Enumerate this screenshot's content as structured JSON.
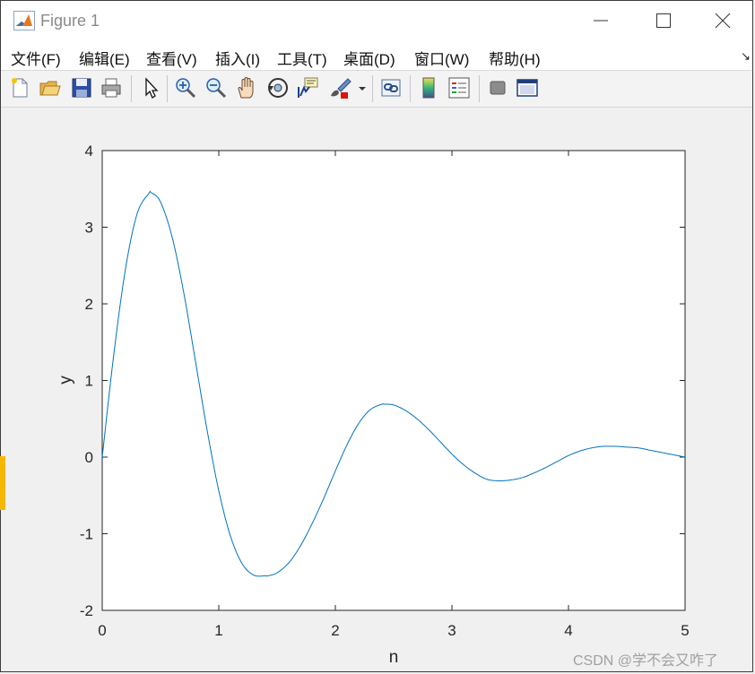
{
  "window": {
    "title": "Figure 1",
    "icon": "matlab-icon",
    "controls": [
      "minimize-icon",
      "maximize-icon",
      "close-icon"
    ]
  },
  "menu": [
    {
      "label": "文件(F)"
    },
    {
      "label": "编辑(E)"
    },
    {
      "label": "查看(V)"
    },
    {
      "label": "插入(I)"
    },
    {
      "label": "工具(T)"
    },
    {
      "label": "桌面(D)"
    },
    {
      "label": "窗口(W)"
    },
    {
      "label": "帮助(H)"
    }
  ],
  "toolbar": {
    "icons": [
      "new-figure-icon",
      "open-file-icon",
      "save-icon",
      "print-icon",
      "select-arrow-icon",
      "zoom-in-icon",
      "zoom-out-icon",
      "pan-hand-icon",
      "rotate-3d-icon",
      "data-cursor-icon",
      "brush-icon",
      "brush-dropdown-icon",
      "link-plot-icon",
      "colorbar-icon",
      "legend-icon",
      "hide-plot-tools-icon",
      "show-plot-tools-icon"
    ]
  },
  "chart_data": {
    "type": "line",
    "xlabel": "n",
    "ylabel": "y",
    "title": "",
    "xlim": [
      0,
      5
    ],
    "ylim": [
      -2,
      4
    ],
    "xticks": [
      "0",
      "1",
      "2",
      "3",
      "4",
      "5"
    ],
    "yticks": [
      "-2",
      "-1",
      "0",
      "1",
      "2",
      "3",
      "4"
    ],
    "grid": false,
    "line_color": "#0072bd",
    "series": [
      {
        "x": [
          0,
          0.1,
          0.2,
          0.3,
          0.4,
          0.42,
          0.5,
          0.6,
          0.7,
          0.8,
          0.9,
          1.0,
          1.1,
          1.2,
          1.3,
          1.4,
          1.42,
          1.5,
          1.6,
          1.7,
          1.8,
          1.9,
          2.0,
          2.1,
          2.2,
          2.3,
          2.4,
          2.42,
          2.5,
          2.6,
          2.7,
          2.8,
          2.9,
          3.0,
          3.1,
          3.2,
          3.3,
          3.4,
          3.42,
          3.5,
          3.6,
          3.7,
          3.8,
          3.9,
          4.0,
          4.1,
          4.2,
          4.3,
          4.4,
          4.42,
          4.5,
          4.6,
          4.7,
          4.8,
          4.9,
          5.0
        ],
        "y": [
          0,
          1.35,
          2.46,
          3.18,
          3.44,
          3.45,
          3.33,
          2.87,
          2.14,
          1.25,
          0.35,
          -0.44,
          -1.03,
          -1.39,
          -1.54,
          -1.55,
          -1.55,
          -1.51,
          -1.38,
          -1.16,
          -0.87,
          -0.54,
          -0.18,
          0.16,
          0.44,
          0.62,
          0.69,
          0.69,
          0.68,
          0.61,
          0.5,
          0.36,
          0.2,
          0.04,
          -0.1,
          -0.21,
          -0.29,
          -0.31,
          -0.31,
          -0.3,
          -0.27,
          -0.21,
          -0.14,
          -0.06,
          0.02,
          0.08,
          0.12,
          0.14,
          0.14,
          0.14,
          0.13,
          0.12,
          0.09,
          0.06,
          0.03,
          0
        ]
      }
    ]
  },
  "watermark": "CSDN @学不会又咋了"
}
